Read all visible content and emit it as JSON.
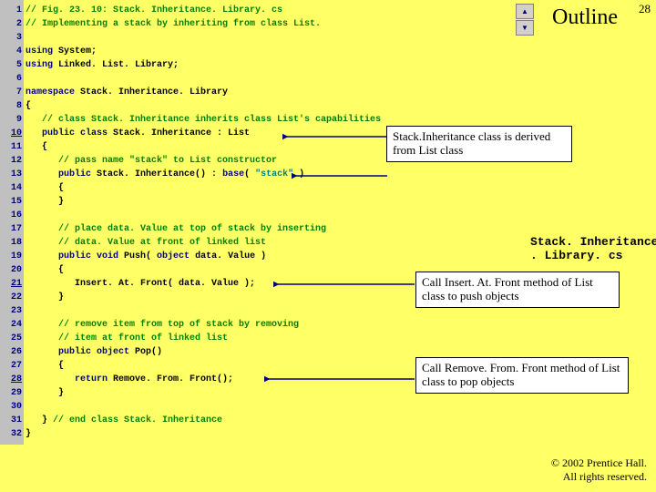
{
  "pageNumber": "28",
  "outline": "Outline",
  "lineCount": 32,
  "underlinedLines": [
    10,
    21,
    28
  ],
  "fileLabel": "Stack. Inheritance\n. Library. cs",
  "copyright": "© 2002 Prentice Hall.\nAll rights reserved.",
  "callouts": {
    "co1": "Stack.Inheritance class is derived from List class",
    "co2": "Call Insert. At. Front method of List class to push objects",
    "co3": "Call Remove. From. Front method of List class to pop objects"
  },
  "code": [
    [
      {
        "cls": "c-comment",
        "txt": "// Fig. 23. 10: Stack. Inheritance. Library. cs"
      }
    ],
    [
      {
        "cls": "c-comment",
        "txt": "// Implementing a stack by inheriting from class List."
      }
    ],
    [],
    [
      {
        "cls": "c-key",
        "txt": "using "
      },
      {
        "cls": "c-norm",
        "txt": "System;"
      }
    ],
    [
      {
        "cls": "c-key",
        "txt": "using "
      },
      {
        "cls": "c-norm",
        "txt": "Linked. List. Library;"
      }
    ],
    [],
    [
      {
        "cls": "c-key",
        "txt": "namespace "
      },
      {
        "cls": "c-norm",
        "txt": "Stack. Inheritance. Library"
      }
    ],
    [
      {
        "cls": "c-norm",
        "txt": "{"
      }
    ],
    [
      {
        "cls": "c-comment",
        "txt": "   // class Stack. Inheritance inherits class List's capabilities"
      }
    ],
    [
      {
        "cls": "c-norm",
        "txt": "   "
      },
      {
        "cls": "c-key",
        "txt": "public class "
      },
      {
        "cls": "c-norm",
        "txt": "Stack. Inheritance : List"
      }
    ],
    [
      {
        "cls": "c-norm",
        "txt": "   {"
      }
    ],
    [
      {
        "cls": "c-comment",
        "txt": "      // pass name \"stack\" to List constructor"
      }
    ],
    [
      {
        "cls": "c-norm",
        "txt": "      "
      },
      {
        "cls": "c-key",
        "txt": "public "
      },
      {
        "cls": "c-norm",
        "txt": "Stack. Inheritance() : "
      },
      {
        "cls": "c-key",
        "txt": "base"
      },
      {
        "cls": "c-norm",
        "txt": "( "
      },
      {
        "cls": "c-str",
        "txt": "\"stack\""
      },
      {
        "cls": "c-norm",
        "txt": " )"
      }
    ],
    [
      {
        "cls": "c-norm",
        "txt": "      {"
      }
    ],
    [
      {
        "cls": "c-norm",
        "txt": "      }"
      }
    ],
    [],
    [
      {
        "cls": "c-comment",
        "txt": "      // place data. Value at top of stack by inserting"
      }
    ],
    [
      {
        "cls": "c-comment",
        "txt": "      // data. Value at front of linked list"
      }
    ],
    [
      {
        "cls": "c-norm",
        "txt": "      "
      },
      {
        "cls": "c-key",
        "txt": "public void "
      },
      {
        "cls": "c-norm",
        "txt": "Push( "
      },
      {
        "cls": "c-key",
        "txt": "object "
      },
      {
        "cls": "c-norm",
        "txt": "data. Value )"
      }
    ],
    [
      {
        "cls": "c-norm",
        "txt": "      {"
      }
    ],
    [
      {
        "cls": "c-norm",
        "txt": "         Insert. At. Front( data. Value );"
      }
    ],
    [
      {
        "cls": "c-norm",
        "txt": "      }"
      }
    ],
    [],
    [
      {
        "cls": "c-comment",
        "txt": "      // remove item from top of stack by removing"
      }
    ],
    [
      {
        "cls": "c-comment",
        "txt": "      // item at front of linked list"
      }
    ],
    [
      {
        "cls": "c-norm",
        "txt": "      "
      },
      {
        "cls": "c-key",
        "txt": "public object "
      },
      {
        "cls": "c-norm",
        "txt": "Pop()"
      }
    ],
    [
      {
        "cls": "c-norm",
        "txt": "      {"
      }
    ],
    [
      {
        "cls": "c-norm",
        "txt": "         "
      },
      {
        "cls": "c-key",
        "txt": "return "
      },
      {
        "cls": "c-norm",
        "txt": "Remove. From. Front();"
      }
    ],
    [
      {
        "cls": "c-norm",
        "txt": "      }"
      }
    ],
    [],
    [
      {
        "cls": "c-norm",
        "txt": "   } "
      },
      {
        "cls": "c-comment",
        "txt": "// end class Stack. Inheritance"
      }
    ],
    [
      {
        "cls": "c-norm",
        "txt": "}"
      }
    ]
  ]
}
